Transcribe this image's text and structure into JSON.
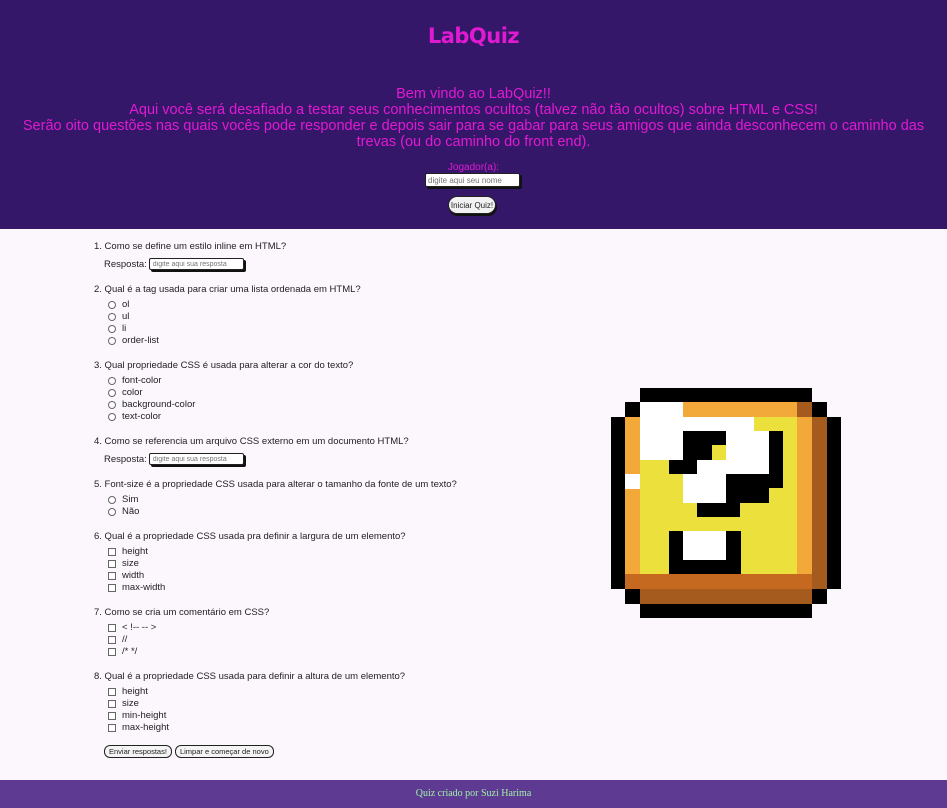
{
  "header": {
    "logo": "LabQuiz",
    "welcome_lines": [
      "Bem vindo ao LabQuiz!!",
      "Aqui você será desafiado a testar seus conhecimentos ocultos (talvez não tão ocultos) sobre HTML e CSS!",
      "Serão oito questões nas quais vocês pode responder e depois sair para se gabar para seus amigos que ainda desconhecem o caminho das trevas (ou do caminho do front end)."
    ],
    "player_label": "Jogador(a):",
    "name_placeholder": "digite aqui seu nome",
    "start_button": "Iniciar Quiz!"
  },
  "questions": {
    "q1": {
      "text": "1. Como se define um estilo inline em HTML?",
      "answer_label": "Resposta:",
      "placeholder": "digite aqui sua resposta"
    },
    "q2": {
      "text": "2. Qual é a tag usada para criar uma lista ordenada em HTML?",
      "options": [
        "ol",
        "ul",
        "li",
        "order-list"
      ]
    },
    "q3": {
      "text": "3. Qual propriedade CSS é usada para alterar a cor do texto?",
      "options": [
        "font-color",
        "color",
        "background-color",
        "text-color"
      ]
    },
    "q4": {
      "text": "4. Como se referencia um arquivo CSS externo em um documento HTML?",
      "answer_label": "Resposta:",
      "placeholder": "digite aqui sua resposta"
    },
    "q5": {
      "text": "5. Font-size é a propriedade CSS usada para alterar o tamanho da fonte de um texto?",
      "options": [
        "Sim",
        "Não"
      ]
    },
    "q6": {
      "text": "6. Qual é a propriedade CSS usada pra definir a largura de um elemento?",
      "options": [
        "height",
        "size",
        "width",
        "max-width"
      ]
    },
    "q7": {
      "text": "7. Como se cria um comentário em CSS?",
      "options": [
        "< !-- -- >",
        "//",
        "/* */"
      ]
    },
    "q8": {
      "text": "8. Qual é a propriedade CSS usada para definir a altura de um elemento?",
      "options": [
        "height",
        "size",
        "min-height",
        "max-height"
      ]
    }
  },
  "actions": {
    "submit": "Enviar respostas!",
    "reset": "Limpar e começar de novo"
  },
  "footer": {
    "credit": "Quiz criado por Suzi Harima"
  },
  "colors": {
    "header_bg": "#35176a",
    "accent_pink": "#e01ad1",
    "footer_bg": "#5f3a93",
    "footer_text": "#9ef0a8",
    "block_yellow": "#ece03c",
    "block_orange": "#f3a83a",
    "block_brown": "#a55a1e"
  },
  "illustration": "question-block-icon"
}
